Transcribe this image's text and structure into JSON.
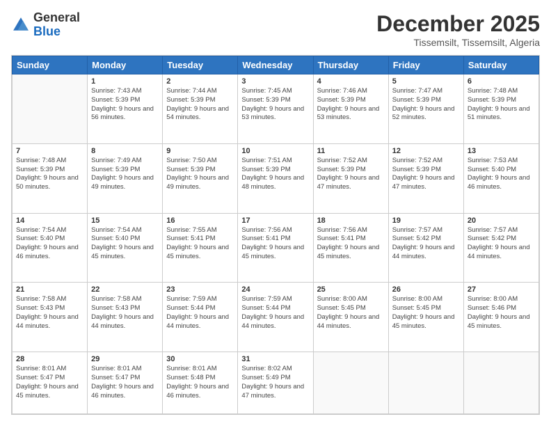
{
  "logo": {
    "general": "General",
    "blue": "Blue"
  },
  "header": {
    "month": "December 2025",
    "location": "Tissemsilt, Tissemsilt, Algeria"
  },
  "days": {
    "headers": [
      "Sunday",
      "Monday",
      "Tuesday",
      "Wednesday",
      "Thursday",
      "Friday",
      "Saturday"
    ]
  },
  "weeks": [
    {
      "cells": [
        {
          "empty": true
        },
        {
          "num": "1",
          "sunrise": "7:43 AM",
          "sunset": "5:39 PM",
          "daylight": "9 hours and 56 minutes."
        },
        {
          "num": "2",
          "sunrise": "7:44 AM",
          "sunset": "5:39 PM",
          "daylight": "9 hours and 54 minutes."
        },
        {
          "num": "3",
          "sunrise": "7:45 AM",
          "sunset": "5:39 PM",
          "daylight": "9 hours and 53 minutes."
        },
        {
          "num": "4",
          "sunrise": "7:46 AM",
          "sunset": "5:39 PM",
          "daylight": "9 hours and 53 minutes."
        },
        {
          "num": "5",
          "sunrise": "7:47 AM",
          "sunset": "5:39 PM",
          "daylight": "9 hours and 52 minutes."
        },
        {
          "num": "6",
          "sunrise": "7:48 AM",
          "sunset": "5:39 PM",
          "daylight": "9 hours and 51 minutes."
        }
      ]
    },
    {
      "cells": [
        {
          "num": "7",
          "sunrise": "7:48 AM",
          "sunset": "5:39 PM",
          "daylight": "9 hours and 50 minutes."
        },
        {
          "num": "8",
          "sunrise": "7:49 AM",
          "sunset": "5:39 PM",
          "daylight": "9 hours and 49 minutes."
        },
        {
          "num": "9",
          "sunrise": "7:50 AM",
          "sunset": "5:39 PM",
          "daylight": "9 hours and 49 minutes."
        },
        {
          "num": "10",
          "sunrise": "7:51 AM",
          "sunset": "5:39 PM",
          "daylight": "9 hours and 48 minutes."
        },
        {
          "num": "11",
          "sunrise": "7:52 AM",
          "sunset": "5:39 PM",
          "daylight": "9 hours and 47 minutes."
        },
        {
          "num": "12",
          "sunrise": "7:52 AM",
          "sunset": "5:39 PM",
          "daylight": "9 hours and 47 minutes."
        },
        {
          "num": "13",
          "sunrise": "7:53 AM",
          "sunset": "5:40 PM",
          "daylight": "9 hours and 46 minutes."
        }
      ]
    },
    {
      "cells": [
        {
          "num": "14",
          "sunrise": "7:54 AM",
          "sunset": "5:40 PM",
          "daylight": "9 hours and 46 minutes."
        },
        {
          "num": "15",
          "sunrise": "7:54 AM",
          "sunset": "5:40 PM",
          "daylight": "9 hours and 45 minutes."
        },
        {
          "num": "16",
          "sunrise": "7:55 AM",
          "sunset": "5:41 PM",
          "daylight": "9 hours and 45 minutes."
        },
        {
          "num": "17",
          "sunrise": "7:56 AM",
          "sunset": "5:41 PM",
          "daylight": "9 hours and 45 minutes."
        },
        {
          "num": "18",
          "sunrise": "7:56 AM",
          "sunset": "5:41 PM",
          "daylight": "9 hours and 45 minutes."
        },
        {
          "num": "19",
          "sunrise": "7:57 AM",
          "sunset": "5:42 PM",
          "daylight": "9 hours and 44 minutes."
        },
        {
          "num": "20",
          "sunrise": "7:57 AM",
          "sunset": "5:42 PM",
          "daylight": "9 hours and 44 minutes."
        }
      ]
    },
    {
      "cells": [
        {
          "num": "21",
          "sunrise": "7:58 AM",
          "sunset": "5:43 PM",
          "daylight": "9 hours and 44 minutes."
        },
        {
          "num": "22",
          "sunrise": "7:58 AM",
          "sunset": "5:43 PM",
          "daylight": "9 hours and 44 minutes."
        },
        {
          "num": "23",
          "sunrise": "7:59 AM",
          "sunset": "5:44 PM",
          "daylight": "9 hours and 44 minutes."
        },
        {
          "num": "24",
          "sunrise": "7:59 AM",
          "sunset": "5:44 PM",
          "daylight": "9 hours and 44 minutes."
        },
        {
          "num": "25",
          "sunrise": "8:00 AM",
          "sunset": "5:45 PM",
          "daylight": "9 hours and 44 minutes."
        },
        {
          "num": "26",
          "sunrise": "8:00 AM",
          "sunset": "5:45 PM",
          "daylight": "9 hours and 45 minutes."
        },
        {
          "num": "27",
          "sunrise": "8:00 AM",
          "sunset": "5:46 PM",
          "daylight": "9 hours and 45 minutes."
        }
      ]
    },
    {
      "cells": [
        {
          "num": "28",
          "sunrise": "8:01 AM",
          "sunset": "5:47 PM",
          "daylight": "9 hours and 45 minutes."
        },
        {
          "num": "29",
          "sunrise": "8:01 AM",
          "sunset": "5:47 PM",
          "daylight": "9 hours and 46 minutes."
        },
        {
          "num": "30",
          "sunrise": "8:01 AM",
          "sunset": "5:48 PM",
          "daylight": "9 hours and 46 minutes."
        },
        {
          "num": "31",
          "sunrise": "8:02 AM",
          "sunset": "5:49 PM",
          "daylight": "9 hours and 47 minutes."
        },
        {
          "empty": true
        },
        {
          "empty": true
        },
        {
          "empty": true
        }
      ]
    }
  ],
  "labels": {
    "sunrise": "Sunrise:",
    "sunset": "Sunset:",
    "daylight": "Daylight:"
  }
}
